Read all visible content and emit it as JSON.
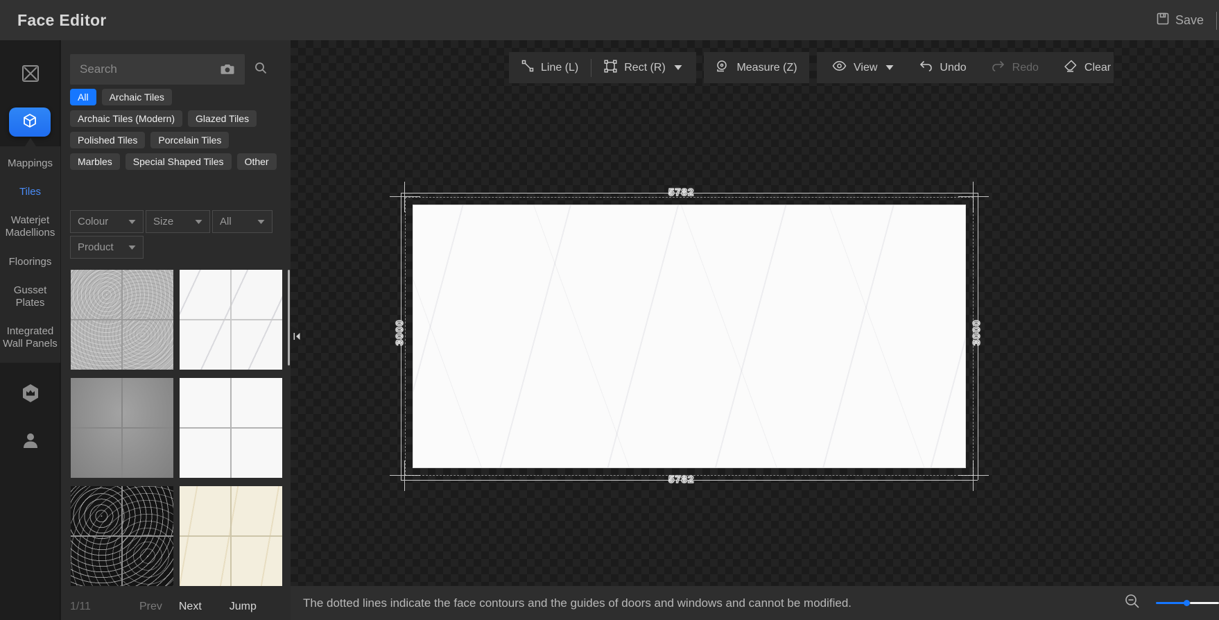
{
  "header": {
    "title": "Face Editor",
    "save": "Save"
  },
  "sidebar": {
    "items": [
      {
        "label": "Mappings",
        "active": false
      },
      {
        "label": "Tiles",
        "active": true
      },
      {
        "label": "Waterjet Madellions",
        "active": false
      },
      {
        "label": "Floorings",
        "active": false
      },
      {
        "label": "Gusset Plates",
        "active": false
      },
      {
        "label": "Integrated Wall Panels",
        "active": false
      }
    ]
  },
  "library": {
    "search": {
      "placeholder": "Search"
    },
    "categories": [
      {
        "label": "All",
        "active": true
      },
      {
        "label": "Archaic Tiles",
        "active": false
      },
      {
        "label": "Archaic Tiles (Modern)",
        "active": false
      },
      {
        "label": "Glazed Tiles",
        "active": false
      },
      {
        "label": "Polished Tiles",
        "active": false
      },
      {
        "label": "Porcelain Tiles",
        "active": false
      },
      {
        "label": "Marbles",
        "active": false
      },
      {
        "label": "Special Shaped Tiles",
        "active": false
      },
      {
        "label": "Other",
        "active": false
      }
    ],
    "filters": {
      "colour": "Colour",
      "size": "Size",
      "all": "All",
      "product": "Product"
    },
    "tiles": [
      {
        "name": "grey-granite-tile"
      },
      {
        "name": "white-marble-tile"
      },
      {
        "name": "grey-concrete-tile"
      },
      {
        "name": "white-plain-tile"
      },
      {
        "name": "black-marble-tile"
      },
      {
        "name": "cream-marble-tile"
      }
    ],
    "pagination": {
      "page_indicator": "1/11",
      "prev": "Prev",
      "next": "Next",
      "jump": "Jump"
    }
  },
  "toolbar": {
    "line": "Line (L)",
    "rect": "Rect (R)",
    "measure": "Measure (Z)",
    "view": "View",
    "undo": "Undo",
    "redo": "Redo",
    "clear": "Clear"
  },
  "canvas": {
    "face": {
      "width_label": "5782",
      "height_label": "3000"
    }
  },
  "statusbar": {
    "message": "The dotted lines indicate the face contours and the guides of doors and windows and cannot be modified."
  },
  "colors": {
    "accent": "#1677ff",
    "face_fill": "#fbfbfb",
    "canvas_dark": "#1b1b1b"
  }
}
